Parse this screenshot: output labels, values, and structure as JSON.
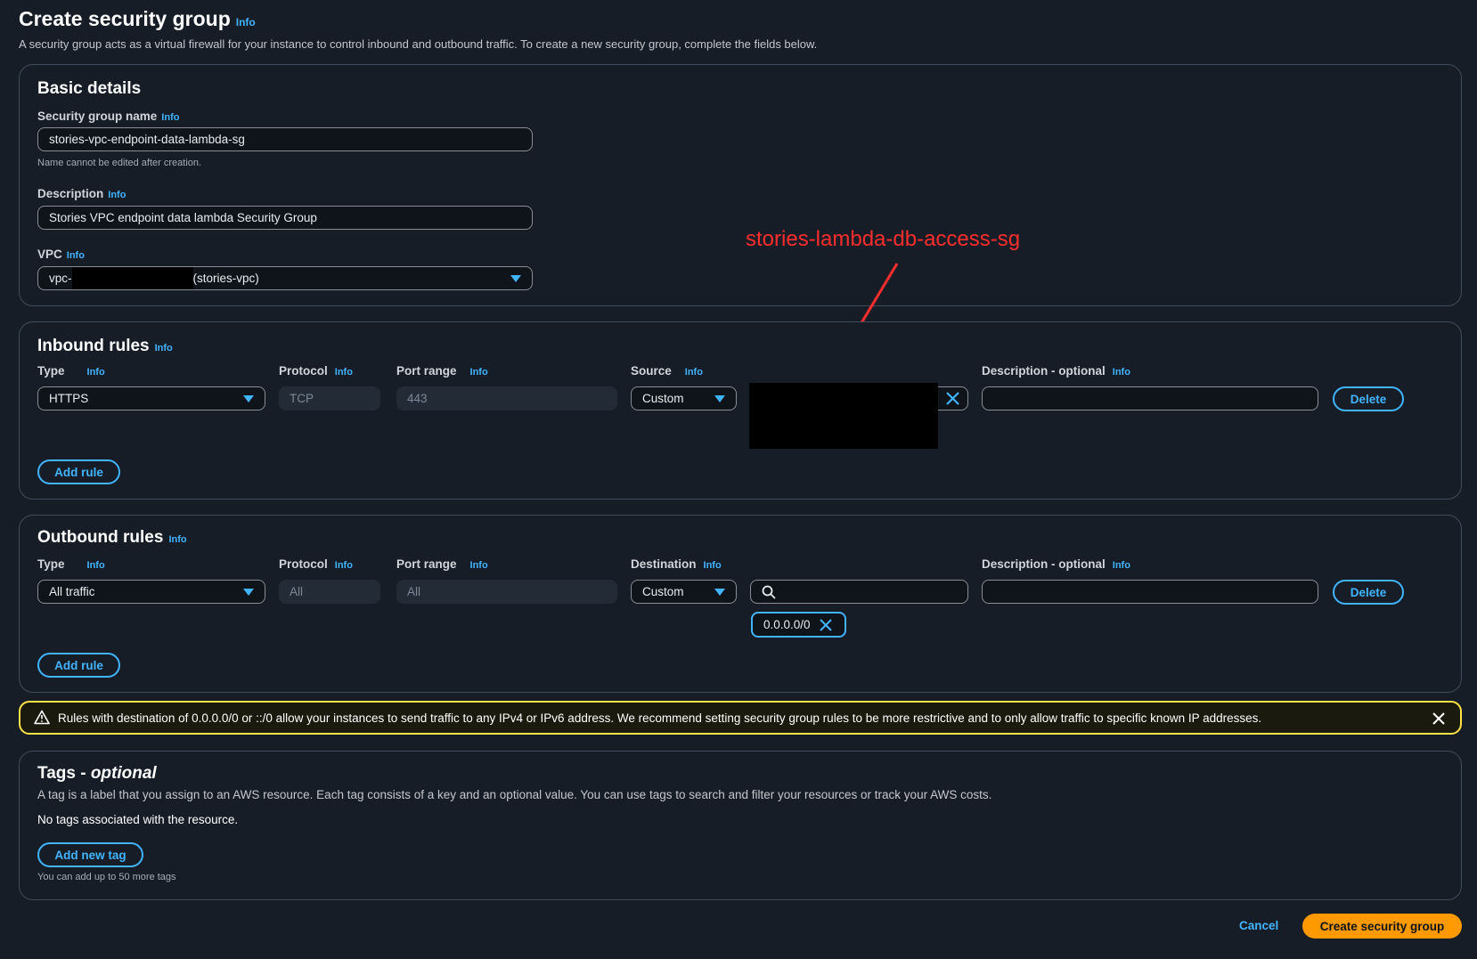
{
  "header": {
    "title": "Create security group",
    "info": "Info",
    "description": "A security group acts as a virtual firewall for your instance to control inbound and outbound traffic. To create a new security group, complete the fields below."
  },
  "basic_details": {
    "title": "Basic details",
    "name_label": "Security group name",
    "name_value": "stories-vpc-endpoint-data-lambda-sg",
    "name_hint": "Name cannot be edited after creation.",
    "description_label": "Description",
    "description_value": "Stories VPC endpoint  data lambda Security Group",
    "vpc_label": "VPC",
    "vpc_prefix": "vpc-",
    "vpc_suffix": "(stories-vpc)"
  },
  "annotation": {
    "text": "stories-lambda-db-access-sg",
    "color": "#ff2d2d"
  },
  "inbound": {
    "title": "Inbound rules",
    "type_label": "Type",
    "protocol_label": "Protocol",
    "port_label": "Port range",
    "source_label": "Source",
    "desc_label": "Description - optional",
    "type_value": "HTTPS",
    "protocol_value": "TCP",
    "port_value": "443",
    "source_value": "Custom",
    "delete_label": "Delete",
    "add_rule_label": "Add rule"
  },
  "outbound": {
    "title": "Outbound rules",
    "type_label": "Type",
    "protocol_label": "Protocol",
    "port_label": "Port range",
    "destination_label": "Destination",
    "desc_label": "Description - optional",
    "type_value": "All traffic",
    "protocol_value": "All",
    "port_value": "All",
    "destination_value": "Custom",
    "cidr_token": "0.0.0.0/0",
    "delete_label": "Delete",
    "add_rule_label": "Add rule"
  },
  "warning": {
    "text": "Rules with destination of 0.0.0.0/0 or ::/0 allow your instances to send traffic to any IPv4 or IPv6 address. We recommend setting security group rules to be more restrictive and to only allow traffic to specific known IP addresses."
  },
  "tags": {
    "title_main": "Tags - ",
    "title_optional": "optional",
    "description": "A tag is a label that you assign to an AWS resource. Each tag consists of a key and an optional value. You can use tags to search and filter your resources or track your AWS costs.",
    "empty": "No tags associated with the resource.",
    "add_label": "Add new tag",
    "hint": "You can add up to 50 more tags"
  },
  "footer": {
    "cancel_label": "Cancel",
    "create_label": "Create security group"
  },
  "colors": {
    "accent": "#42b4ff",
    "primary": "#ff9900",
    "warning": "#ffe347",
    "background": "#161d26"
  }
}
